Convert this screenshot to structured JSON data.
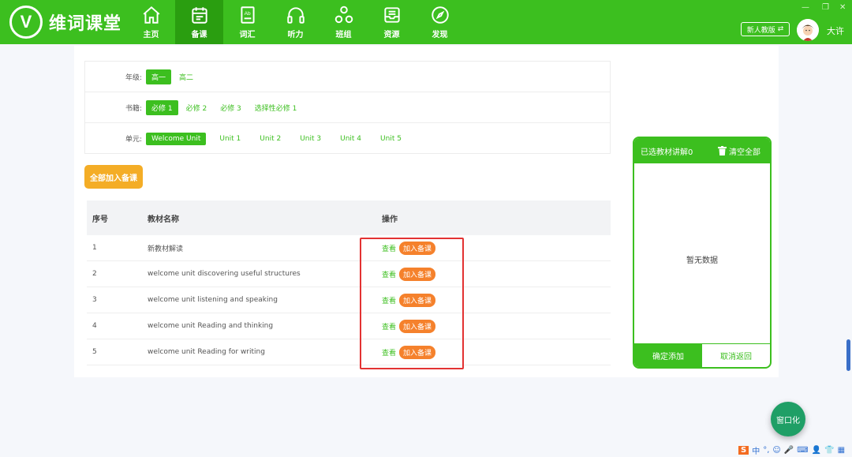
{
  "app": {
    "name": "维词课堂",
    "logo_letter": "V"
  },
  "nav": [
    {
      "label": "主页",
      "icon": "home-icon"
    },
    {
      "label": "备课",
      "icon": "calendar-icon",
      "active": true
    },
    {
      "label": "词汇",
      "icon": "book-icon"
    },
    {
      "label": "听力",
      "icon": "headphones-icon"
    },
    {
      "label": "班组",
      "icon": "group-icon"
    },
    {
      "label": "资源",
      "icon": "inbox-icon"
    },
    {
      "label": "发现",
      "icon": "compass-icon"
    }
  ],
  "header": {
    "version_btn": "新人教版",
    "user_name": "大许"
  },
  "filters": {
    "grade_label": "年级:",
    "grade_options": [
      "高一",
      "高二"
    ],
    "book_label": "书籍:",
    "book_options": [
      "必修 1",
      "必修 2",
      "必修 3",
      "选择性必修 1"
    ],
    "unit_label": "单元:",
    "unit_options": [
      "Welcome Unit",
      "Unit 1",
      "Unit 2",
      "Unit 3",
      "Unit 4",
      "Unit 5"
    ]
  },
  "add_all_button": "全部加入备课",
  "table": {
    "headers": [
      "序号",
      "教材名称",
      "操作"
    ],
    "view_label": "查看",
    "add_label": "加入备课",
    "rows": [
      {
        "no": "1",
        "name": "新教材解读"
      },
      {
        "no": "2",
        "name": "welcome unit discovering useful structures"
      },
      {
        "no": "3",
        "name": "welcome unit listening and speaking"
      },
      {
        "no": "4",
        "name": "welcome unit Reading and thinking"
      },
      {
        "no": "5",
        "name": "welcome unit Reading for writing"
      }
    ]
  },
  "selected_panel": {
    "title": "已选教材讲解0",
    "clear_all": "清空全部",
    "empty_text": "暂无数据",
    "confirm": "确定添加",
    "cancel": "取消返回"
  },
  "float_button": "窗口化",
  "tray": {
    "ime": "中"
  },
  "colors": {
    "brand": "#3cbf1f",
    "orange": "#f5812c",
    "amber": "#f4ad26",
    "highlight": "#e33232"
  }
}
